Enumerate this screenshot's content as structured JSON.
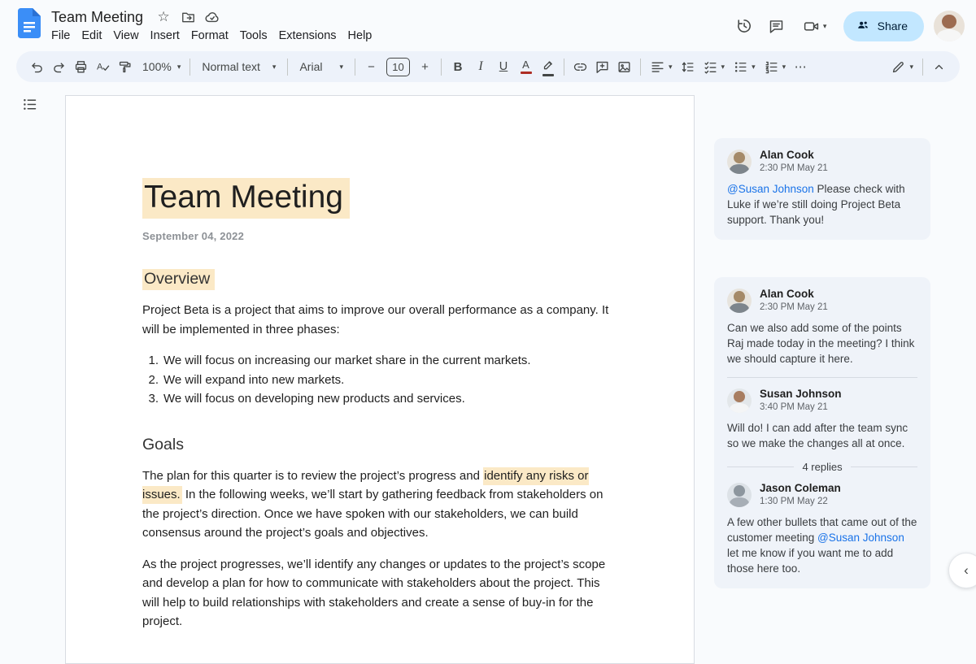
{
  "header": {
    "doc_title": "Team Meeting",
    "menus": [
      "File",
      "Edit",
      "View",
      "Insert",
      "Format",
      "Tools",
      "Extensions",
      "Help"
    ],
    "share_label": "Share"
  },
  "toolbar": {
    "zoom_value": "100%",
    "paragraph_style": "Normal text",
    "font_family": "Arial",
    "font_size": "10",
    "decrease_font_label": "−",
    "increase_font_label": "+",
    "bold_label": "B",
    "italic_label": "I",
    "underline_label": "U",
    "text_color_label": "A",
    "spellcheck_label": "A",
    "more_label": "⋯"
  },
  "doc": {
    "title": "Team Meeting",
    "date": "September 04, 2022",
    "overview_heading": "Overview",
    "overview_paragraph": "Project Beta is a project that aims to improve our overall performance as a company. It will be implemented in three phases:",
    "list": [
      {
        "num": "1.",
        "text": "We will focus on increasing our market share in the current markets."
      },
      {
        "num": "2.",
        "text": "We will expand into new markets."
      },
      {
        "num": "3.",
        "text": "We will focus on developing new products and services."
      }
    ],
    "goals_heading": "Goals",
    "goals_p1_before": "The plan for this quarter is to review the project’s progress and ",
    "goals_p1_highlight": "identify any risks or issues.",
    "goals_p1_after": " In the following weeks, we’ll start by gathering feedback from stakeholders on the project’s direction. Once we have spoken with our stakeholders, we can build consensus around the project’s goals and objectives.",
    "goals_p2": "As the project progresses, we’ll identify any changes or updates to the project’s scope and develop a plan for how to communicate with stakeholders about the project. This will help to build relationships with stakeholders and create a sense of buy-in for the project."
  },
  "comments": {
    "card1": {
      "author": "Alan Cook",
      "time": "2:30 PM May 21",
      "mention": "@Susan Johnson",
      "text_after": " Please check with Luke if we’re still doing Project Beta support. Thank you!"
    },
    "card2": {
      "root": {
        "author": "Alan Cook",
        "time": "2:30 PM May 21",
        "text": "Can we also add some of the points Raj made today in the meeting? I think we should capture it here."
      },
      "reply1": {
        "author": "Susan Johnson",
        "time": "3:40 PM May 21",
        "text": "Will do! I can add after the team sync so we make the changes all at once."
      },
      "replies_label": "4 replies",
      "reply2": {
        "author": "Jason Coleman",
        "time": "1:30 PM May 22",
        "text_before": "A few other bullets that came out of the customer meeting ",
        "mention": "@Susan Johnson",
        "text_after": " let me know if you want me to add those here too."
      }
    }
  },
  "colors": {
    "highlight": "#fbe9c6",
    "share_button_bg": "#c2e7ff",
    "share_button_text": "#001d35",
    "toolbar_bg": "#edf2fa",
    "app_bg": "#f9fbfd",
    "comment_card_bg": "#eff3f9",
    "mention_blue": "#1a73e8",
    "docs_logo_blue": "#3b8ef7",
    "icon_gray": "#444746",
    "text_color_bar": "#ae2e24"
  },
  "icons": {
    "star": "☆",
    "caret_down": "▾",
    "collapse_comments": "‹"
  }
}
